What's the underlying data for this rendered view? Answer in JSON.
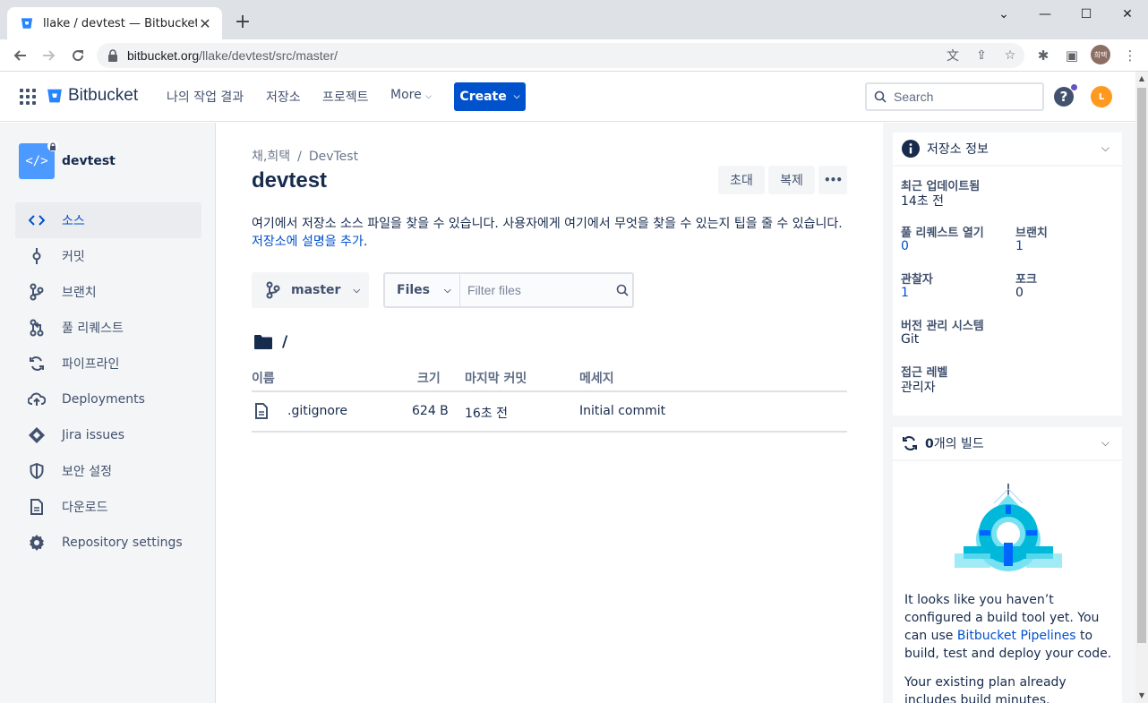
{
  "browser": {
    "tab_title": "llake / devtest — Bitbucket",
    "url_host": "bitbucket.org",
    "url_path": "/llake/devtest/src/master/",
    "profile_initials": "희택"
  },
  "header": {
    "brand": "Bitbucket",
    "nav": [
      "나의 작업 결과",
      "저장소",
      "프로젝트",
      "More"
    ],
    "create_label": "Create",
    "search_placeholder": "Search",
    "help_label": "?",
    "avatar_initial": "L"
  },
  "sidebar": {
    "repo_name": "devtest",
    "repo_icon_text": "</>",
    "items": [
      {
        "label": "소스",
        "icon": "code-icon",
        "active": true
      },
      {
        "label": "커밋",
        "icon": "commit-icon"
      },
      {
        "label": "브랜치",
        "icon": "branch-icon"
      },
      {
        "label": "풀 리퀘스트",
        "icon": "pull-request-icon"
      },
      {
        "label": "파이프라인",
        "icon": "pipelines-icon"
      },
      {
        "label": "Deployments",
        "icon": "cloud-upload-icon"
      },
      {
        "label": "Jira issues",
        "icon": "jira-icon"
      },
      {
        "label": "보안 설정",
        "icon": "shield-icon"
      },
      {
        "label": "다운로드",
        "icon": "document-icon"
      },
      {
        "label": "Repository settings",
        "icon": "gear-icon"
      }
    ]
  },
  "main": {
    "breadcrumb": [
      "채,희택",
      "DevTest"
    ],
    "breadcrumb_sep": "/",
    "title": "devtest",
    "invite_label": "초대",
    "clone_label": "복제",
    "more_label": "•••",
    "desc_text": "여기에서 저장소 소스 파일을 찾을 수 있습니다. 사용자에게 여기에서 무엇을 찾을 수 있는지 팁을 줄 수 있습니다. ",
    "desc_link": "저장소에 설명을 추가",
    "desc_end": ".",
    "branch": "master",
    "files_select": "Files",
    "filter_placeholder": "Filter files",
    "path": "/",
    "columns": [
      "이름",
      "크기",
      "마지막 커밋",
      "메세지"
    ],
    "rows": [
      {
        "name": ".gitignore",
        "size": "624 B",
        "last_commit": "16초 전",
        "message": "Initial commit"
      }
    ]
  },
  "repo_info": {
    "title": "저장소 정보",
    "last_updated_label": "최근 업데이트됨",
    "last_updated": "14초 전",
    "open_prs_label": "풀 리퀘스트 열기",
    "open_prs": "0",
    "branches_label": "브랜치",
    "branches": "1",
    "watchers_label": "관찰자",
    "watchers": "1",
    "forks_label": "포크",
    "forks": "0",
    "vcs_label": "버전 관리 시스템",
    "vcs": "Git",
    "access_label": "접근 레벨",
    "access": "관리자"
  },
  "builds": {
    "count": "0",
    "title_suffix": "개의 빌드",
    "text1": "It looks like you haven’t configured a build tool yet. You can use ",
    "link": "Bitbucket Pipelines",
    "text2": " to build, test and deploy your code.",
    "text3": "Your existing plan already includes build minutes."
  },
  "colors": {
    "primary": "#0052cc",
    "sidebar_bg": "#f4f5f7",
    "text": "#172b4d"
  }
}
